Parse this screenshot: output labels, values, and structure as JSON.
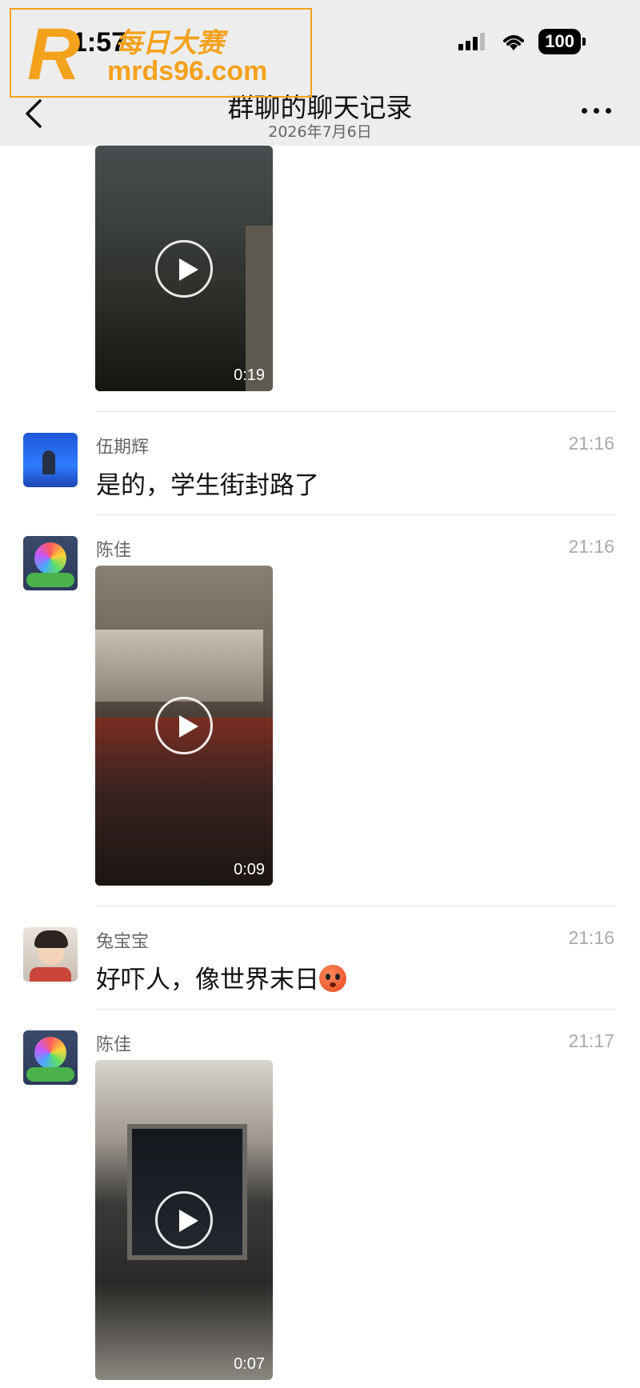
{
  "status_bar": {
    "time": "1:57",
    "battery": "100"
  },
  "header": {
    "title": "群聊的聊天记录",
    "subtitle": "2026年7月6日"
  },
  "watermark": {
    "title": "每日大赛",
    "url": "mrds96.com",
    "logo_letter": "R"
  },
  "messages": [
    {
      "type": "video",
      "duration": "0:19"
    },
    {
      "sender": "伍期辉",
      "time": "21:16",
      "type": "text",
      "text": "是的，学生街封路了"
    },
    {
      "sender": "陈佳",
      "time": "21:16",
      "type": "video",
      "duration": "0:09"
    },
    {
      "sender": "兔宝宝",
      "time": "21:16",
      "type": "text",
      "text": "好吓人，像世界末日",
      "emoji": "anxious-sweat-emoji"
    },
    {
      "sender": "陈佳",
      "time": "21:17",
      "type": "video",
      "duration": "0:07"
    }
  ],
  "icons": {
    "back": "chevron-left-icon",
    "more": "more-dots-icon",
    "play": "play-icon",
    "signal": "signal-icon",
    "wifi": "wifi-icon"
  }
}
